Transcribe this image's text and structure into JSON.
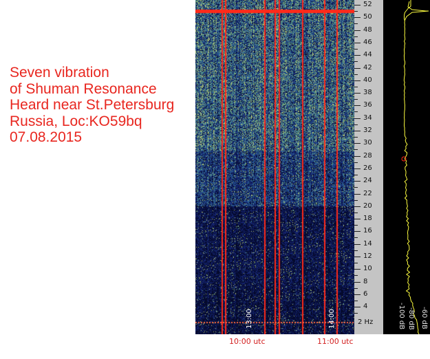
{
  "caption": {
    "lines": [
      "Seven vibration",
      "of Shuman Resonance",
      "Heard near St.Petersburg",
      "Russia, Loc:KO59bq",
      "07.08.2015"
    ]
  },
  "frequency_scale": {
    "unit_label": "2 Hz",
    "ticks": [
      "52",
      "50",
      "48",
      "46",
      "44",
      "42",
      "40",
      "38",
      "36",
      "34",
      "32",
      "30",
      "28",
      "26",
      "24",
      "22",
      "20",
      "18",
      "16",
      "14",
      "12",
      "10",
      "8",
      "6",
      "4"
    ]
  },
  "time_axis": {
    "bottom_labels": [
      "10:00 utc",
      "11:00 utc"
    ],
    "vertical_labels": [
      "13:00",
      "14:00"
    ]
  },
  "profile_axis": {
    "labels": [
      "-100 dB",
      "-80 dB",
      "-60 dB"
    ]
  },
  "colors": {
    "caption": "#e8261f",
    "marker_red": "#ff2a1a",
    "profile_trace": "#ffff40",
    "scale_bg": "#c4c4c4"
  }
}
